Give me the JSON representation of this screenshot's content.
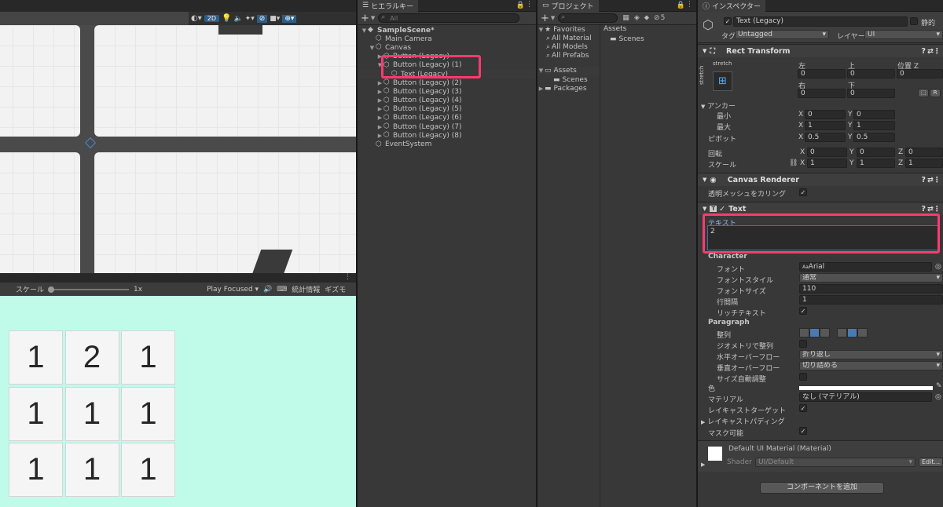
{
  "scene_toolbar": {
    "mode_2d": "2D"
  },
  "game_toolbar": {
    "scale_label": "スケール",
    "scale_value": "1x",
    "play_mode": "Play Focused",
    "stats": "統計情報",
    "gizmos": "ギズモ"
  },
  "game_grid": [
    "1",
    "2",
    "1",
    "1",
    "1",
    "1",
    "1",
    "1",
    "1"
  ],
  "hierarchy": {
    "tab": "ヒエラルキー",
    "search_placeholder": "All",
    "items": [
      {
        "label": "SampleScene*",
        "depth": 0,
        "arrow": "▼",
        "icon": "unity-scene-icon"
      },
      {
        "label": "Main Camera",
        "depth": 1,
        "arrow": "",
        "icon": "gameobject-icon"
      },
      {
        "label": "Canvas",
        "depth": 1,
        "arrow": "▼",
        "icon": "gameobject-icon"
      },
      {
        "label": "Button (Legacy)",
        "depth": 2,
        "arrow": "▶",
        "icon": "gameobject-icon"
      },
      {
        "label": "Button (Legacy) (1)",
        "depth": 2,
        "arrow": "▼",
        "icon": "gameobject-icon"
      },
      {
        "label": "Text (Legacy)",
        "depth": 3,
        "arrow": "",
        "icon": "gameobject-icon",
        "selected": true
      },
      {
        "label": "Button (Legacy) (2)",
        "depth": 2,
        "arrow": "▶",
        "icon": "gameobject-icon"
      },
      {
        "label": "Button (Legacy) (3)",
        "depth": 2,
        "arrow": "▶",
        "icon": "gameobject-icon"
      },
      {
        "label": "Button (Legacy) (4)",
        "depth": 2,
        "arrow": "▶",
        "icon": "gameobject-icon"
      },
      {
        "label": "Button (Legacy) (5)",
        "depth": 2,
        "arrow": "▶",
        "icon": "gameobject-icon"
      },
      {
        "label": "Button (Legacy) (6)",
        "depth": 2,
        "arrow": "▶",
        "icon": "gameobject-icon"
      },
      {
        "label": "Button (Legacy) (7)",
        "depth": 2,
        "arrow": "▶",
        "icon": "gameobject-icon"
      },
      {
        "label": "Button (Legacy) (8)",
        "depth": 2,
        "arrow": "▶",
        "icon": "gameobject-icon"
      },
      {
        "label": "EventSystem",
        "depth": 1,
        "arrow": "",
        "icon": "gameobject-icon"
      }
    ]
  },
  "project": {
    "tab": "プロジェクト",
    "badge": "5",
    "favorites": {
      "label": "Favorites",
      "items": [
        "All Material",
        "All Models",
        "All Prefabs"
      ]
    },
    "assets": {
      "label": "Assets",
      "items": [
        "Scenes"
      ]
    },
    "packages": "Packages",
    "breadcrumb": "Assets",
    "content": [
      "Scenes"
    ]
  },
  "inspector": {
    "tab": "インスペクター",
    "object_name": "Text (Legacy)",
    "static_label": "静的",
    "tag_label": "タグ",
    "tag_value": "Untagged",
    "layer_label": "レイヤー",
    "layer_value": "UI",
    "rect": {
      "title": "Rect Transform",
      "stretch_h": "stretch",
      "stretch_v": "stretch",
      "left_label": "左",
      "top_label": "上",
      "posz_label": "位置 Z",
      "left": "0",
      "top": "0",
      "posz": "0",
      "right_label": "右",
      "bottom_label": "下",
      "right": "0",
      "bottom": "0",
      "anchor_label": "アンカー",
      "min_label": "最小",
      "max_label": "最大",
      "pivot_label": "ピボット",
      "min_x": "0",
      "min_y": "0",
      "max_x": "1",
      "max_y": "1",
      "pivot_x": "0.5",
      "pivot_y": "0.5",
      "rot_label": "回転",
      "rot_x": "0",
      "rot_y": "0",
      "rot_z": "0",
      "scale_label": "スケール",
      "scale_x": "1",
      "scale_y": "1",
      "scale_z": "1",
      "x": "X",
      "y": "Y",
      "z": "Z",
      "r": "R"
    },
    "canvas_renderer": {
      "title": "Canvas Renderer",
      "cull_label": "透明メッシュをカリング"
    },
    "text": {
      "title": "Text",
      "text_label": "テキスト",
      "text_value": "2",
      "character_label": "Character",
      "font_label": "フォント",
      "font_value": "Arial",
      "style_label": "フォントスタイル",
      "style_value": "通常",
      "size_label": "フォントサイズ",
      "size_value": "110",
      "line_label": "行間隔",
      "line_value": "1",
      "rich_label": "リッチテキスト",
      "paragraph_label": "Paragraph",
      "align_label": "整列",
      "geo_label": "ジオメトリで整列",
      "hover_label": "水平オーバーフロー",
      "hover_value": "折り返し",
      "vover_label": "垂直オーバーフロー",
      "vover_value": "切り詰める",
      "best_label": "サイズ自動調整",
      "color_label": "色",
      "material_label": "マテリアル",
      "material_value": "なし (マテリアル)",
      "raycast_label": "レイキャストターゲット",
      "padding_label": "レイキャストパディング",
      "mask_label": "マスク可能"
    },
    "material": {
      "title": "Default UI Material (Material)",
      "shader_label": "Shader",
      "shader_value": "UI/Default",
      "edit": "Edit..."
    },
    "add_component": "コンポーネントを追加"
  },
  "colors": {
    "highlight": "#ff3a6e",
    "game_bg": "#c0fbea",
    "selection": "#2c5d87"
  }
}
